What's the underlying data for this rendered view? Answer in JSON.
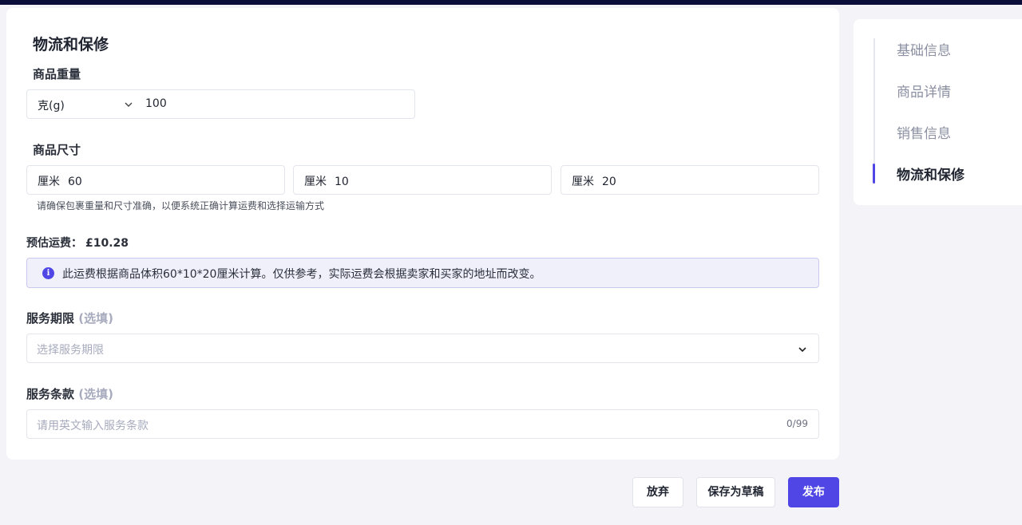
{
  "section": {
    "title": "物流和保修"
  },
  "weight": {
    "label": "商品重量",
    "unit": "克(g)",
    "value": "100"
  },
  "dimensions": {
    "label": "商品尺寸",
    "fields": [
      {
        "unit": "厘米",
        "value": "60"
      },
      {
        "unit": "厘米",
        "value": "10"
      },
      {
        "unit": "厘米",
        "value": "20"
      }
    ],
    "hint": "请确保包裹重量和尺寸准确，以便系统正确计算运费和选择运输方式"
  },
  "shipping": {
    "label": "预估运费：",
    "price": "£10.28",
    "notice": "此运费根据商品体积60*10*20厘米计算。仅供参考，实际运费会根据卖家和买家的地址而改变。",
    "info_icon": "info-icon"
  },
  "service_period": {
    "label": "服务期限",
    "optional": "(选填)",
    "placeholder": "选择服务期限"
  },
  "service_terms": {
    "label": "服务条款",
    "optional": "(选填)",
    "placeholder": "请用英文输入服务条款",
    "counter": "0/99"
  },
  "nav": {
    "items": [
      {
        "label": "基础信息"
      },
      {
        "label": "商品详情"
      },
      {
        "label": "销售信息"
      },
      {
        "label": "物流和保修"
      }
    ],
    "active_index": 3
  },
  "actions": {
    "discard": "放弃",
    "save_draft": "保存为草稿",
    "publish": "发布"
  },
  "colors": {
    "accent": "#4f46e5",
    "top_bar": "#0b0e3a",
    "notice_bg": "#f0f0fb"
  }
}
